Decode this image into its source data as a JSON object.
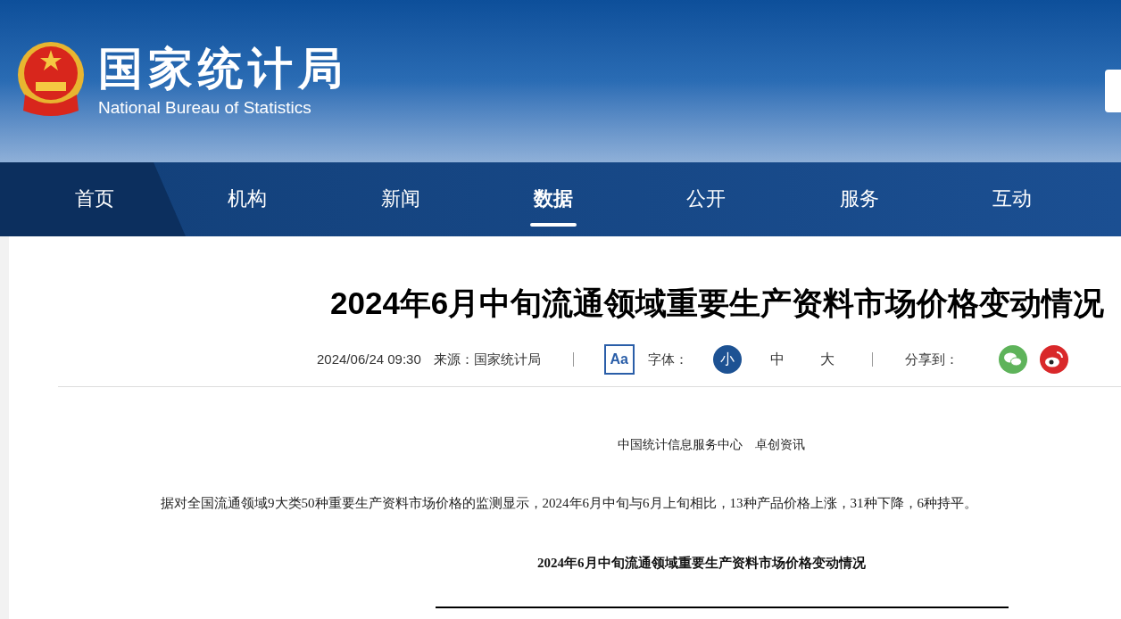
{
  "header": {
    "title": "国家统计局",
    "subtitle": "National Bureau of Statistics"
  },
  "nav": [
    {
      "label": "首页",
      "selected": false
    },
    {
      "label": "机构",
      "selected": false
    },
    {
      "label": "新闻",
      "selected": false
    },
    {
      "label": "数据",
      "selected": true
    },
    {
      "label": "公开",
      "selected": false
    },
    {
      "label": "服务",
      "selected": false
    },
    {
      "label": "互动",
      "selected": false
    }
  ],
  "article": {
    "title": "2024年6月中旬流通领域重要生产资料市场价格变动情况",
    "date": "2024/06/24 09:30",
    "source": "来源：国家统计局",
    "font_icon": "Aa",
    "font_label": "字体：",
    "font_sizes": [
      {
        "label": "小",
        "selected": true
      },
      {
        "label": "中",
        "selected": false
      },
      {
        "label": "大",
        "selected": false
      }
    ],
    "share_label": "分享到：",
    "byline": "中国统计信息服务中心　卓创资讯",
    "paragraph": "据对全国流通领域9大类50种重要生产资料市场价格的监测显示，2024年6月中旬与6月上旬相比，13种产品价格上涨，31种下降，6种持平。",
    "table_title": "2024年6月中旬流通领域重要生产资料市场价格变动情况"
  }
}
